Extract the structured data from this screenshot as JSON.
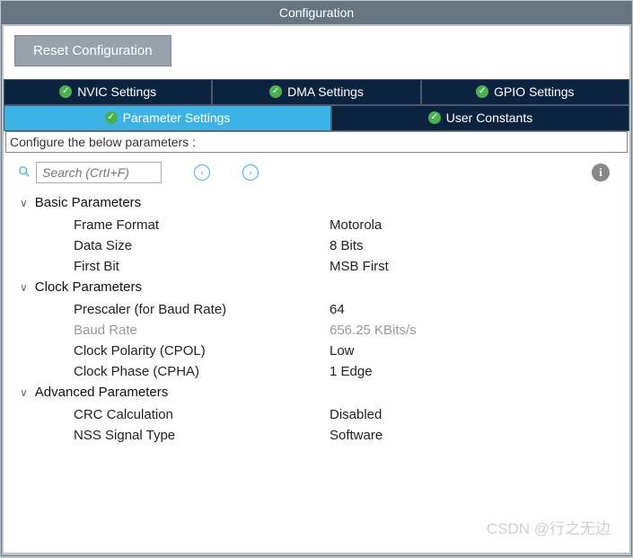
{
  "window": {
    "title": "Configuration"
  },
  "buttons": {
    "reset": "Reset Configuration"
  },
  "tabs": {
    "nvic": "NVIC Settings",
    "dma": "DMA Settings",
    "gpio": "GPIO Settings",
    "param": "Parameter Settings",
    "user": "User Constants"
  },
  "filter": {
    "label": "Configure the below parameters :"
  },
  "search": {
    "placeholder": "Search (CrtI+F)"
  },
  "sections": {
    "basic": {
      "title": "Basic Parameters",
      "rows": {
        "frame_format": {
          "label": "Frame Format",
          "value": "Motorola"
        },
        "data_size": {
          "label": "Data Size",
          "value": "8 Bits"
        },
        "first_bit": {
          "label": "First Bit",
          "value": "MSB First"
        }
      }
    },
    "clock": {
      "title": "Clock Parameters",
      "rows": {
        "prescaler": {
          "label": "Prescaler (for Baud Rate)",
          "value": "64"
        },
        "baud_rate": {
          "label": "Baud Rate",
          "value": "656.25 KBits/s"
        },
        "cpol": {
          "label": "Clock Polarity (CPOL)",
          "value": "Low"
        },
        "cpha": {
          "label": "Clock Phase (CPHA)",
          "value": "1 Edge"
        }
      }
    },
    "advanced": {
      "title": "Advanced Parameters",
      "rows": {
        "crc": {
          "label": "CRC Calculation",
          "value": "Disabled"
        },
        "nss": {
          "label": "NSS Signal Type",
          "value": "Software"
        }
      }
    }
  },
  "watermark": "CSDN @行之无边"
}
